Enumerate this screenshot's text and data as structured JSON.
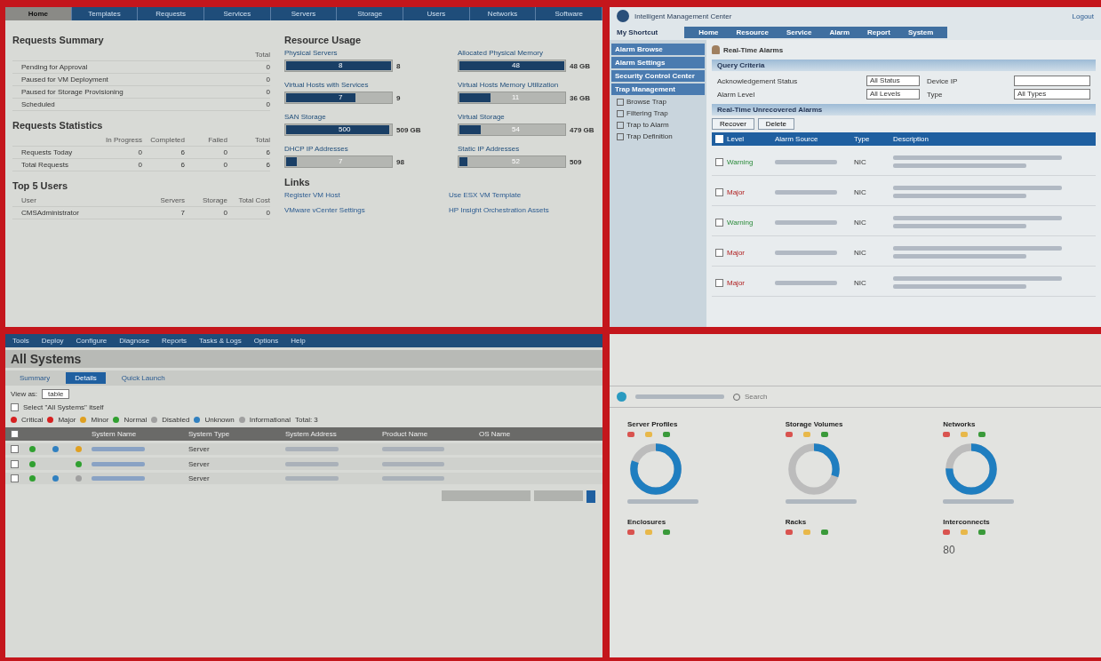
{
  "home_panel": {
    "tabs": [
      {
        "label": "Home",
        "selected": true
      },
      {
        "label": "Templates",
        "selected": false
      },
      {
        "label": "Requests",
        "selected": false
      },
      {
        "label": "Services",
        "selected": false
      },
      {
        "label": "Servers",
        "selected": false
      },
      {
        "label": "Storage",
        "selected": false
      },
      {
        "label": "Users",
        "selected": false
      },
      {
        "label": "Networks",
        "selected": false
      },
      {
        "label": "Software",
        "selected": false
      }
    ],
    "requests_summary": {
      "title": "Requests Summary",
      "total_header": "Total",
      "rows": [
        {
          "label": "Pending for Approval",
          "value": "0"
        },
        {
          "label": "Paused for VM Deployment",
          "value": "0"
        },
        {
          "label": "Paused for Storage Provisioning",
          "value": "0"
        },
        {
          "label": "Scheduled",
          "value": "0"
        }
      ]
    },
    "requests_statistics": {
      "title": "Requests Statistics",
      "columns": [
        "In Progress",
        "Completed",
        "Failed",
        "Total"
      ],
      "rows": [
        {
          "label": "Requests Today",
          "values": [
            "0",
            "6",
            "0",
            "6"
          ]
        },
        {
          "label": "Total Requests",
          "values": [
            "0",
            "6",
            "0",
            "6"
          ]
        }
      ]
    },
    "top_users": {
      "title": "Top 5 Users",
      "columns": [
        "User",
        "Servers",
        "Storage",
        "Total Cost"
      ],
      "rows": [
        {
          "values": [
            "CMSAdministrator",
            "7",
            "0",
            "0"
          ]
        }
      ]
    },
    "resource_usage": {
      "title": "Resource Usage",
      "meters": [
        {
          "label": "Physical Servers",
          "inside": "8",
          "outside": "8",
          "level": 1
        },
        {
          "label": "Allocated Physical Memory",
          "inside": "48",
          "outside": "48 GB",
          "level": 1
        },
        {
          "label": "Virtual Hosts with Services",
          "inside": "7",
          "outside": "9",
          "level": 0.66
        },
        {
          "label": "Virtual Hosts Memory Utilization",
          "inside": "11",
          "outside": "36 GB",
          "level": 0.3
        },
        {
          "label": "SAN Storage",
          "inside": "500",
          "outside": "509 GB",
          "level": 0.98
        },
        {
          "label": "Virtual Storage",
          "inside": "54",
          "outside": "479 GB",
          "level": 0.2
        },
        {
          "label": "DHCP IP Addresses",
          "inside": "7",
          "outside": "98",
          "level": 0.1
        },
        {
          "label": "Static IP Addresses",
          "inside": "52",
          "outside": "509",
          "level": 0.08
        }
      ]
    },
    "links": {
      "title": "Links",
      "items": [
        "Register VM Host",
        "Use ESX VM Template",
        "VMware vCenter Settings",
        "HP Insight Orchestration Assets"
      ]
    }
  },
  "imc_panel": {
    "title": "Intelligent Management Center",
    "header_links": [
      "Logout"
    ],
    "shortcut": "My Shortcut",
    "menu": [
      "Home",
      "Resource",
      "Service",
      "Alarm",
      "Report",
      "System"
    ],
    "sidebar_sections": [
      "Alarm Browse",
      "Alarm Settings",
      "Security Control Center",
      "Trap Management"
    ],
    "sidebar_items": [
      "Browse Trap",
      "Filtering Trap",
      "Trap to Alarm",
      "Trap Definition"
    ],
    "page_title": "Real-Time Alarms",
    "criteria_title": "Query Criteria",
    "criteria": [
      {
        "label": "Acknowledgement Status",
        "value": "All Status"
      },
      {
        "label": "Device IP"
      },
      {
        "label": "Alarm Level",
        "value": "All Levels"
      },
      {
        "label": "Type",
        "value": "All Types"
      }
    ],
    "list_title": "Real-Time Unrecovered Alarms",
    "buttons": [
      "Recover",
      "Delete"
    ],
    "header_checked": false,
    "columns": [
      "Level",
      "Alarm Source",
      "Type",
      "Description"
    ],
    "rows": [
      {
        "level": "Warning",
        "kind": "warning",
        "type": "NIC",
        "checked": false
      },
      {
        "level": "Major",
        "kind": "major",
        "type": "NIC",
        "checked": false
      },
      {
        "level": "Warning",
        "kind": "warning",
        "type": "NIC",
        "checked": false
      },
      {
        "level": "Major",
        "kind": "major",
        "type": "NIC",
        "checked": false
      },
      {
        "level": "Major",
        "kind": "major",
        "type": "NIC",
        "checked": false
      }
    ]
  },
  "systems_panel": {
    "menu": [
      "Tools",
      "Deploy",
      "Configure",
      "Diagnose",
      "Reports",
      "Tasks & Logs",
      "Options",
      "Help"
    ],
    "title": "All Systems",
    "tabs": [
      {
        "label": "Summary",
        "selected": false
      },
      {
        "label": "Details",
        "selected": true
      },
      {
        "label": "Quick Launch",
        "selected": false
      }
    ],
    "view_as_label": "View as:",
    "view_as": "table",
    "select_all": {
      "label": "Select \"All Systems\" itself",
      "checked": false
    },
    "legend": [
      {
        "label": "Critical",
        "color": "#d62020"
      },
      {
        "label": "Major",
        "color": "#d62020"
      },
      {
        "label": "Minor",
        "color": "#e0a020"
      },
      {
        "label": "Normal",
        "color": "#30a030"
      },
      {
        "label": "Disabled",
        "color": "#a0a0a0"
      },
      {
        "label": "Unknown",
        "color": "#3080c0"
      },
      {
        "label": "Informational",
        "color": "#a0a0a0"
      }
    ],
    "total": "Total: 3",
    "header_checked": false,
    "columns": [
      "System Name",
      "System Type",
      "System Address",
      "Product Name",
      "OS Name"
    ],
    "rows": [
      {
        "checked": false,
        "status_icons": [
          {
            "kind": "dot",
            "color": "#30a030"
          },
          {
            "kind": "dot",
            "color": "#3080c0"
          },
          {
            "kind": "dot",
            "color": "#e0a020"
          }
        ],
        "type": "Server"
      },
      {
        "checked": false,
        "status_icons": [
          {
            "kind": "dot",
            "color": "#30a030"
          },
          {
            "kind": "blank"
          },
          {
            "kind": "dot",
            "color": "#30a030"
          }
        ],
        "type": "Server"
      },
      {
        "checked": false,
        "status_icons": [
          {
            "kind": "dot",
            "color": "#30a030"
          },
          {
            "kind": "dot",
            "color": "#3080c0"
          },
          {
            "kind": "dot",
            "color": "#a0a0a0"
          }
        ],
        "type": "Server"
      }
    ]
  },
  "oneview_panel": {
    "search": {
      "placeholder": "Search"
    },
    "cards": [
      {
        "kind": "donut",
        "title": "Server Profiles",
        "level": 0.8
      },
      {
        "kind": "donut",
        "title": "Storage Volumes",
        "level": 0.3
      },
      {
        "kind": "donut",
        "title": "Networks",
        "level": 0.75
      },
      {
        "kind": "count",
        "title": "Enclosures"
      },
      {
        "kind": "count",
        "title": "Racks"
      },
      {
        "kind": "count",
        "title": "Interconnects",
        "count": "80"
      }
    ]
  }
}
